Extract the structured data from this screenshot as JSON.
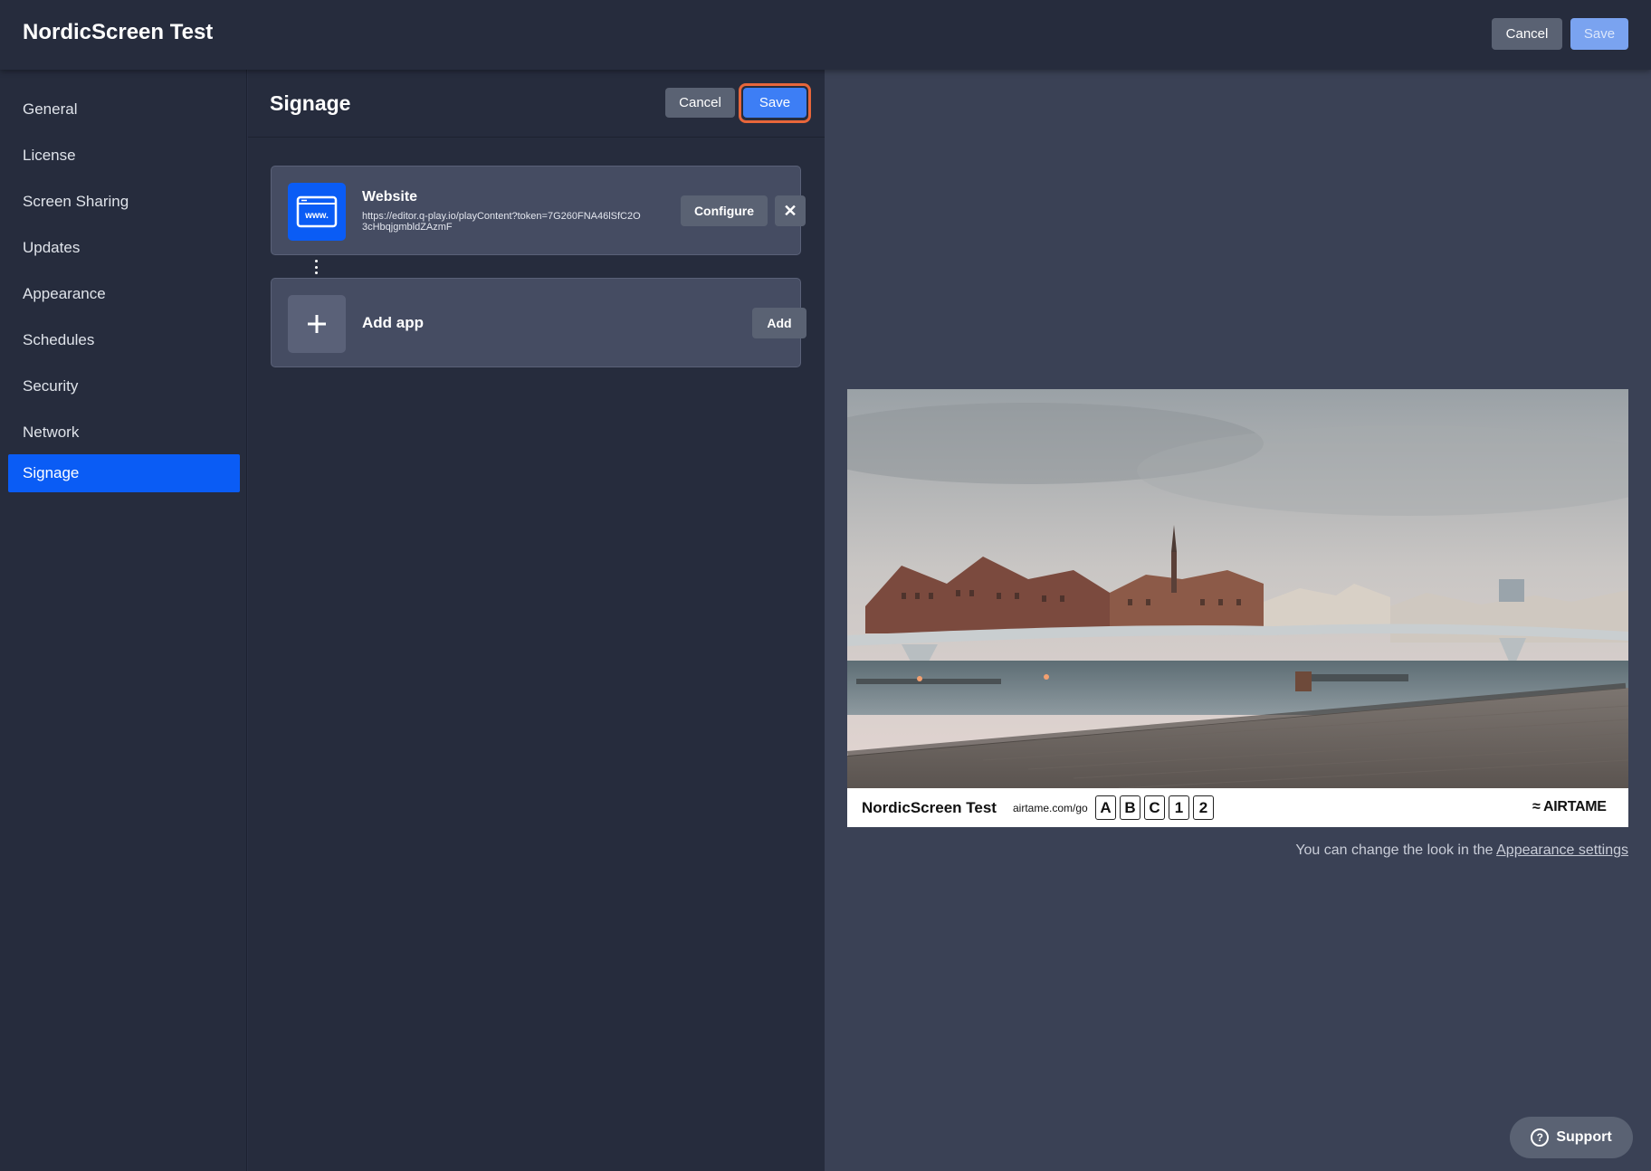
{
  "header": {
    "title": "NordicScreen Test",
    "cancel_label": "Cancel",
    "save_label": "Save"
  },
  "sidebar": {
    "items": [
      {
        "label": "General",
        "active": false
      },
      {
        "label": "License",
        "active": false
      },
      {
        "label": "Screen Sharing",
        "active": false
      },
      {
        "label": "Updates",
        "active": false
      },
      {
        "label": "Appearance",
        "active": false
      },
      {
        "label": "Schedules",
        "active": false
      },
      {
        "label": "Security",
        "active": false
      },
      {
        "label": "Network",
        "active": false
      },
      {
        "label": "Signage",
        "active": true
      }
    ]
  },
  "panel": {
    "title": "Signage",
    "cancel_label": "Cancel",
    "save_label": "Save",
    "apps": [
      {
        "title": "Website",
        "url": "https://editor.q-play.io/playContent?token=7G260FNA46lSfC2O3cHbqjgmbldZAzmF",
        "icon": "www-icon",
        "configure_label": "Configure",
        "remove_label": "✕"
      }
    ],
    "add_app": {
      "title": "Add app",
      "icon": "plus-icon",
      "add_label": "Add"
    }
  },
  "preview": {
    "device_name": "NordicScreen Test",
    "connect_url": "airtame.com/go",
    "code": [
      "A",
      "B",
      "C",
      "1",
      "2"
    ],
    "brand": "≈ AIRTAME",
    "hint_prefix": "You can change the look in the ",
    "hint_link": "Appearance settings"
  },
  "support": {
    "label": "Support",
    "icon": "question-circle-icon"
  },
  "colors": {
    "accent": "#0a5cf5",
    "save_highlight": "#e8663a",
    "background": "#262c3d"
  }
}
